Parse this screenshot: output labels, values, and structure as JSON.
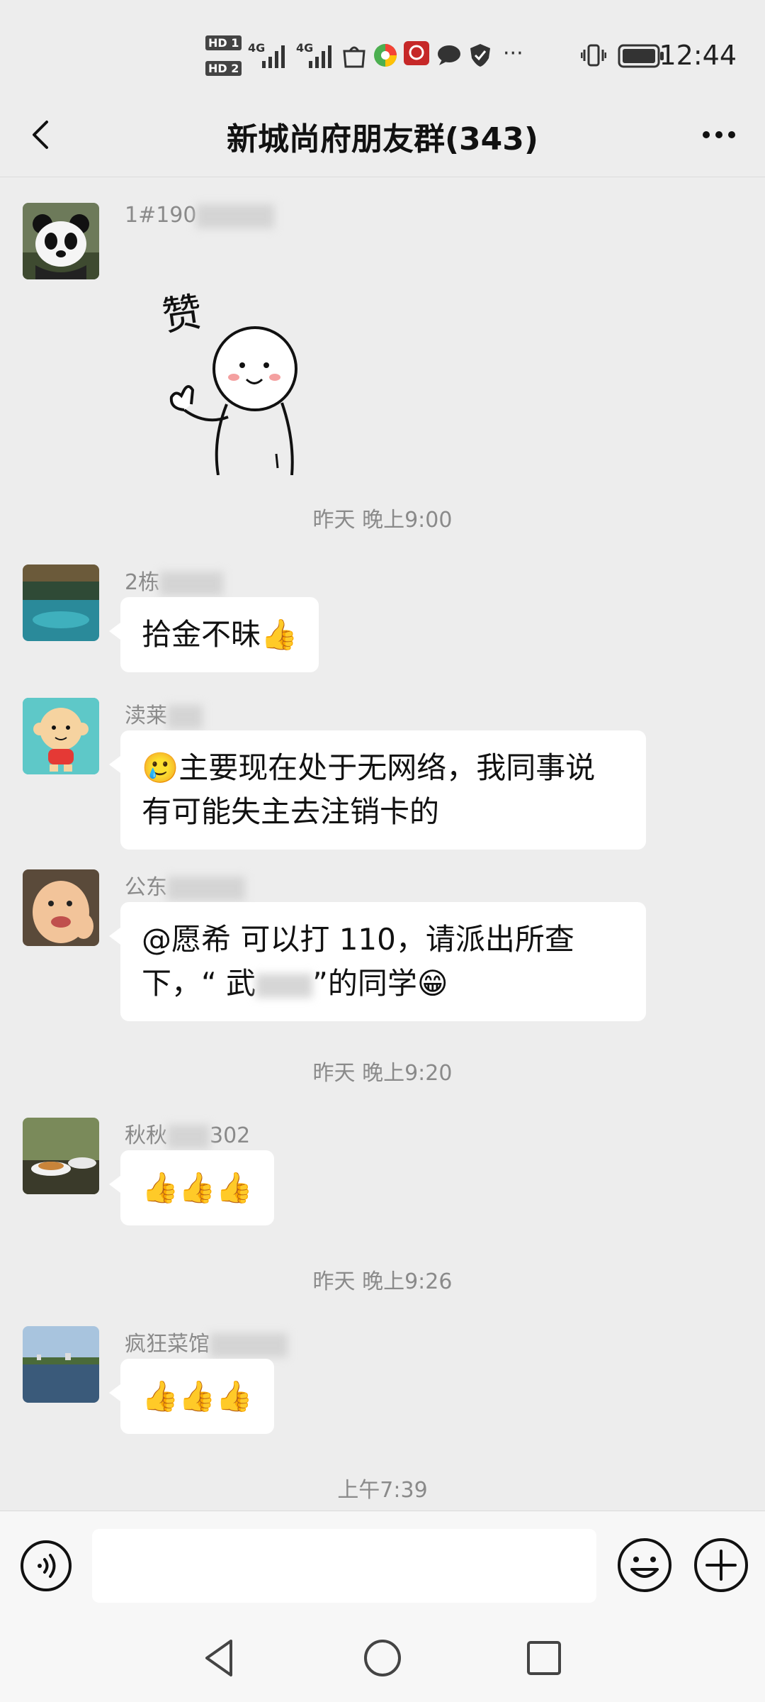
{
  "status_bar": {
    "hd1": "HD 1",
    "hd2": "HD 2",
    "signal1": "4G",
    "signal2": "4G",
    "more": "···",
    "time": "12:44"
  },
  "header": {
    "title": "新城尚府朋友群(343)"
  },
  "messages": [
    {
      "sender": "1#190",
      "sticker_text": "赞"
    },
    {
      "time": "昨天 晚上9:00"
    },
    {
      "sender": "2栋",
      "text": "拾金不昧👍"
    },
    {
      "sender": "渎莱",
      "text_line1": "🥲主要现在处于无网络，我同事说",
      "text_line2": "有可能失主去注销卡的"
    },
    {
      "sender": "公东",
      "text_line1": "@愿希  可以打 110，请派出所查",
      "text_line2a": "下，“ 武",
      "text_line2b": "”的同学😁"
    },
    {
      "time": "昨天 晚上9:20"
    },
    {
      "sender_a": "秋秋",
      "sender_b": "302",
      "text": "👍👍👍"
    },
    {
      "time": "昨天 晚上9:26"
    },
    {
      "sender": "疯狂菜馆",
      "text": "👍👍👍"
    },
    {
      "time": "上午7:39"
    }
  ],
  "input": {
    "placeholder": ""
  },
  "icons": {
    "back": "back-arrow-icon",
    "more": "more-dots-icon",
    "voice": "voice-icon",
    "emoji": "emoji-icon",
    "plus": "plus-icon"
  },
  "colors": {
    "background": "#ededed",
    "bubble": "#ffffff",
    "meta_text": "#8a8a8a"
  }
}
